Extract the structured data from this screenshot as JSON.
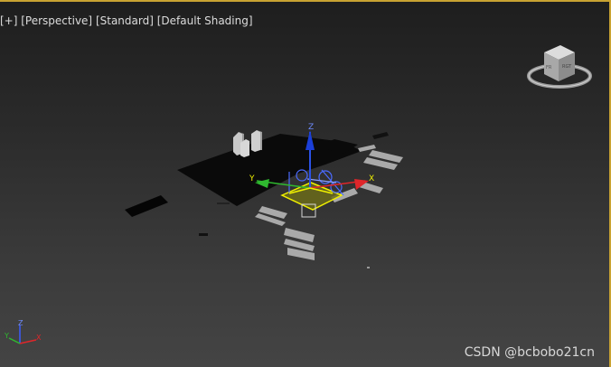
{
  "viewport": {
    "label_plus": "[+]",
    "label_view": "[Perspective]",
    "label_mode": "[Standard]",
    "label_shading": "[Default Shading]"
  },
  "viewcube": {
    "icon": "viewcube-icon"
  },
  "gizmo": {
    "x_label": "X",
    "y_label": "Y",
    "z_label": "Z",
    "x_color": "#e0262a",
    "y_color": "#2fb82f",
    "z_color": "#2b52e8",
    "selection_color": "#f0f000"
  },
  "tripod": {
    "x_label": "X",
    "y_label": "Y",
    "z_label": "Z"
  },
  "watermark": {
    "text": "CSDN @bcbobo21cn"
  },
  "colors": {
    "active_border": "#c8a232",
    "viewport_bg": "#2b2b2b"
  }
}
